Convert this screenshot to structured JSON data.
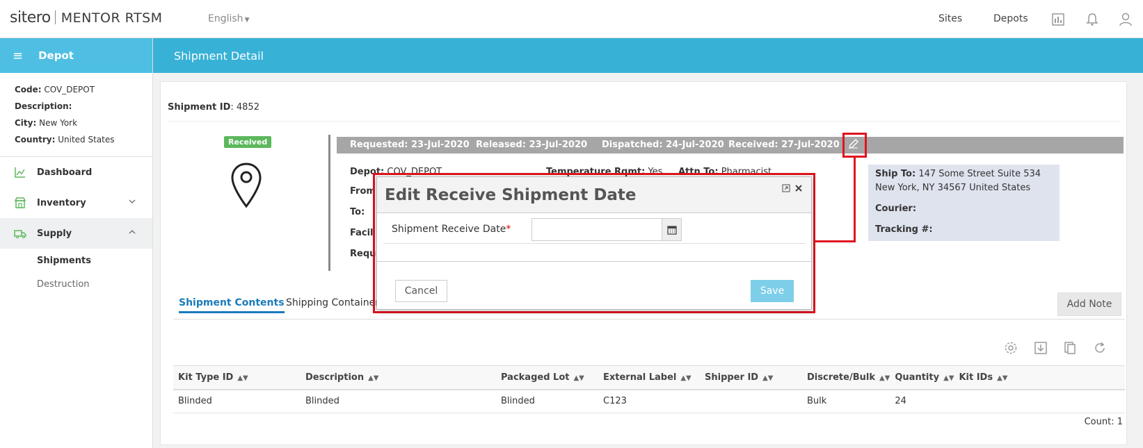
{
  "app": {
    "brand": "sitero",
    "product": "MENTOR RTSM",
    "language": "English"
  },
  "topnav": {
    "sites": "Sites",
    "depots": "Depots"
  },
  "sidebar": {
    "title": "Depot",
    "info": {
      "code_label": "Code:",
      "code_value": "COV_DEPOT",
      "description_label": "Description:",
      "description_value": "",
      "city_label": "City:",
      "city_value": "New York",
      "country_label": "Country:",
      "country_value": "United States"
    },
    "items": [
      {
        "label": "Dashboard"
      },
      {
        "label": "Inventory"
      },
      {
        "label": "Supply"
      }
    ],
    "sub_items": [
      {
        "label": "Shipments"
      },
      {
        "label": "Destruction"
      }
    ]
  },
  "page": {
    "title": "Shipment Detail"
  },
  "shipment": {
    "id_label": "Shipment ID",
    "id_value": "4852",
    "status_badge": "Received",
    "dates": {
      "requested": "Requested: 23-Jul-2020",
      "released": "Released: 23-Jul-2020",
      "dispatched": "Dispatched: 24-Jul-2020",
      "received": "Received: 27-Jul-2020"
    },
    "fields": {
      "depot_label": "Depot:",
      "depot_value": "COV_DEPOT",
      "temp_label": "Temperature Rqmt:",
      "temp_value": "Yes",
      "attn_label": "Attn To:",
      "attn_value": "Pharmacist",
      "from_label": "From",
      "to_label": "To:",
      "facility_label": "Facil",
      "requested_label": "Requ"
    },
    "ship_to": {
      "label": "Ship To:",
      "line1": "147 Some Street Suite 534",
      "line2": "New York, NY 34567 United States",
      "courier_label": "Courier:",
      "tracking_label": "Tracking #:"
    }
  },
  "tabs": [
    {
      "label": "Shipment Contents"
    },
    {
      "label": "Shipping Containers"
    }
  ],
  "add_note": "Add Note",
  "table": {
    "columns": [
      "Kit Type ID",
      "Description",
      "Packaged Lot",
      "External Label",
      "Shipper ID",
      "Discrete/Bulk",
      "Quantity",
      "Kit IDs"
    ],
    "rows": [
      [
        "Blinded",
        "Blinded",
        "Blinded",
        "C123",
        "",
        "Bulk",
        "24",
        ""
      ]
    ],
    "count": "Count: 1"
  },
  "modal": {
    "title": "Edit Receive Shipment Date",
    "field_label": "Shipment Receive Date",
    "required_mark": "*",
    "date_value": "",
    "cancel": "Cancel",
    "save": "Save"
  }
}
